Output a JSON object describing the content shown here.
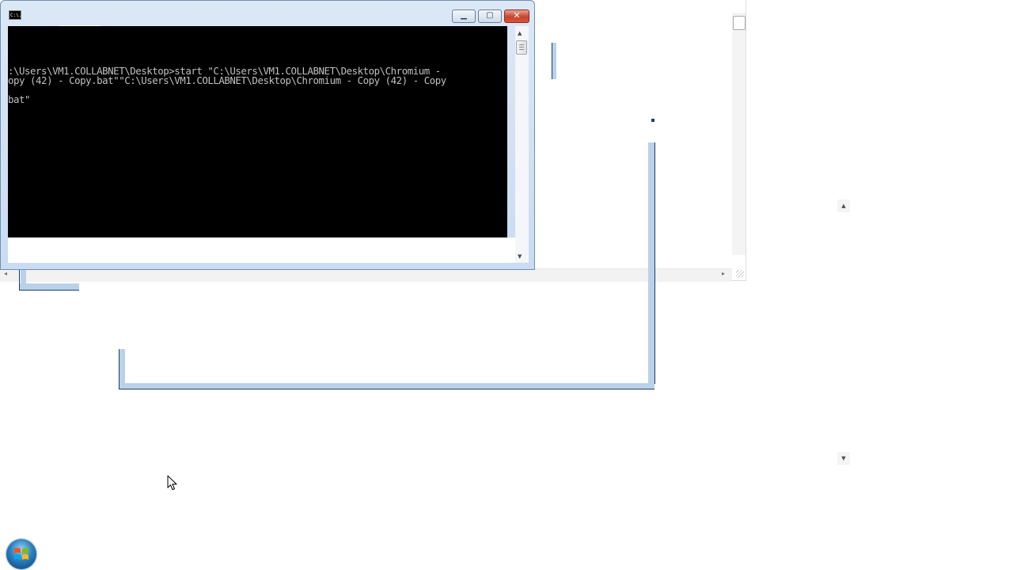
{
  "background_window": {
    "scroll_left_arrow": "◂",
    "scroll_right_arrow": "▸"
  },
  "console": {
    "icon_text": "C:\\.",
    "title": "",
    "buttons": {
      "minimize": "▁",
      "maximize": "▢",
      "close": "✕"
    },
    "lines": [
      ":\\Users\\VM1.COLLABNET\\Desktop>start \"C:\\Users\\VM1.COLLABNET\\Desktop\\Chromium -",
      "opy (42) - Copy.bat\"\"C:\\Users\\VM1.COLLABNET\\Desktop\\Chromium - Copy (42) - Copy",
      "bat\""
    ],
    "scroll_up": "▲",
    "scroll_down": "▼"
  },
  "floating_scroll": {
    "up": "▲",
    "down": "▼"
  },
  "taskbar": {
    "start_button_icon": "windows-logo-icon"
  },
  "colors": {
    "console_background": "#000000",
    "console_text": "#c0c0c0",
    "frame_accent": "#b9d1ea",
    "close_button": "#c7442e"
  }
}
